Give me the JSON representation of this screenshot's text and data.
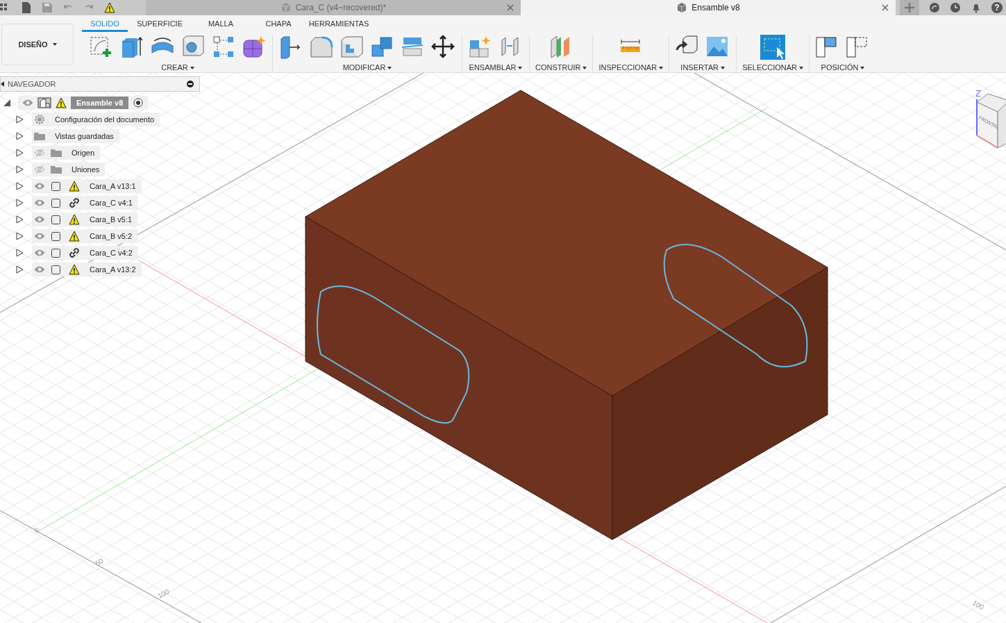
{
  "title_bar": {
    "tabs": [
      {
        "label": "Cara_C (v4~recovered)*",
        "selected": false
      },
      {
        "label": "Ensamble v8",
        "selected": true
      }
    ],
    "help": "?"
  },
  "toolbar": {
    "workspace": "DISEÑO",
    "tabs": [
      {
        "label": "SOLIDO",
        "selected": true
      },
      {
        "label": "SUPERFICIE",
        "selected": false
      },
      {
        "label": "MALLA",
        "selected": false
      },
      {
        "label": "CHAPA",
        "selected": false
      },
      {
        "label": "HERRAMIENTAS",
        "selected": false
      }
    ],
    "groups": [
      {
        "label": "CREAR",
        "tools": [
          {
            "kind": "sketch"
          },
          {
            "kind": "extrude"
          },
          {
            "kind": "revolve"
          },
          {
            "kind": "hole"
          },
          {
            "kind": "pattern"
          },
          {
            "kind": "new-body"
          }
        ]
      },
      {
        "label": "MODIFICAR",
        "tools": [
          {
            "kind": "press-pull"
          },
          {
            "kind": "fillet"
          },
          {
            "kind": "shell"
          },
          {
            "kind": "combine"
          },
          {
            "kind": "split"
          },
          {
            "kind": "move"
          }
        ]
      },
      {
        "label": "ENSAMBLAR",
        "tools": [
          {
            "kind": "new-component"
          },
          {
            "kind": "joint"
          }
        ]
      },
      {
        "label": "CONSTRUIR",
        "tools": [
          {
            "kind": "plane"
          }
        ]
      },
      {
        "label": "INSPECCIONAR",
        "tools": [
          {
            "kind": "measure"
          }
        ]
      },
      {
        "label": "INSERTAR",
        "tools": [
          {
            "kind": "insert"
          },
          {
            "kind": "image"
          }
        ]
      },
      {
        "label": "SELECCIONAR",
        "tools": [
          {
            "kind": "select"
          }
        ]
      },
      {
        "label": "POSICIÓN",
        "tools": [
          {
            "kind": "capture"
          },
          {
            "kind": "revert"
          }
        ]
      }
    ]
  },
  "navigator": {
    "title": "NAVEGADOR",
    "root": {
      "label": "Ensamble v8",
      "expanded": true,
      "visible": true
    },
    "items": [
      {
        "label": "Configuración del documento",
        "kind": "settings",
        "expanded": false
      },
      {
        "label": "Vistas guardadas",
        "kind": "folder",
        "expanded": false
      },
      {
        "label": "Origen",
        "kind": "hidden-folder",
        "expanded": false,
        "visible": false
      },
      {
        "label": "Uniones",
        "kind": "hidden-folder",
        "expanded": false,
        "visible": false
      },
      {
        "label": "Cara_A v13:1",
        "kind": "component",
        "warning": true,
        "expanded": false,
        "visible": true
      },
      {
        "label": "Cara_C v4:1",
        "kind": "component",
        "warning": false,
        "expanded": false,
        "visible": true
      },
      {
        "label": "Cara_B v5:1",
        "kind": "component",
        "warning": true,
        "expanded": false,
        "visible": true
      },
      {
        "label": "Cara_B v5:2",
        "kind": "component",
        "warning": true,
        "expanded": false,
        "visible": true
      },
      {
        "label": "Cara_C v4:2",
        "kind": "component",
        "warning": false,
        "expanded": false,
        "visible": true
      },
      {
        "label": "Cara_A v13:2",
        "kind": "component",
        "warning": true,
        "expanded": false,
        "visible": true
      }
    ]
  },
  "viewport": {
    "axis_labels": [
      "0",
      "50",
      "100",
      "100"
    ],
    "view_cube": {
      "axis": "Z",
      "face": "FRONTAL"
    }
  }
}
